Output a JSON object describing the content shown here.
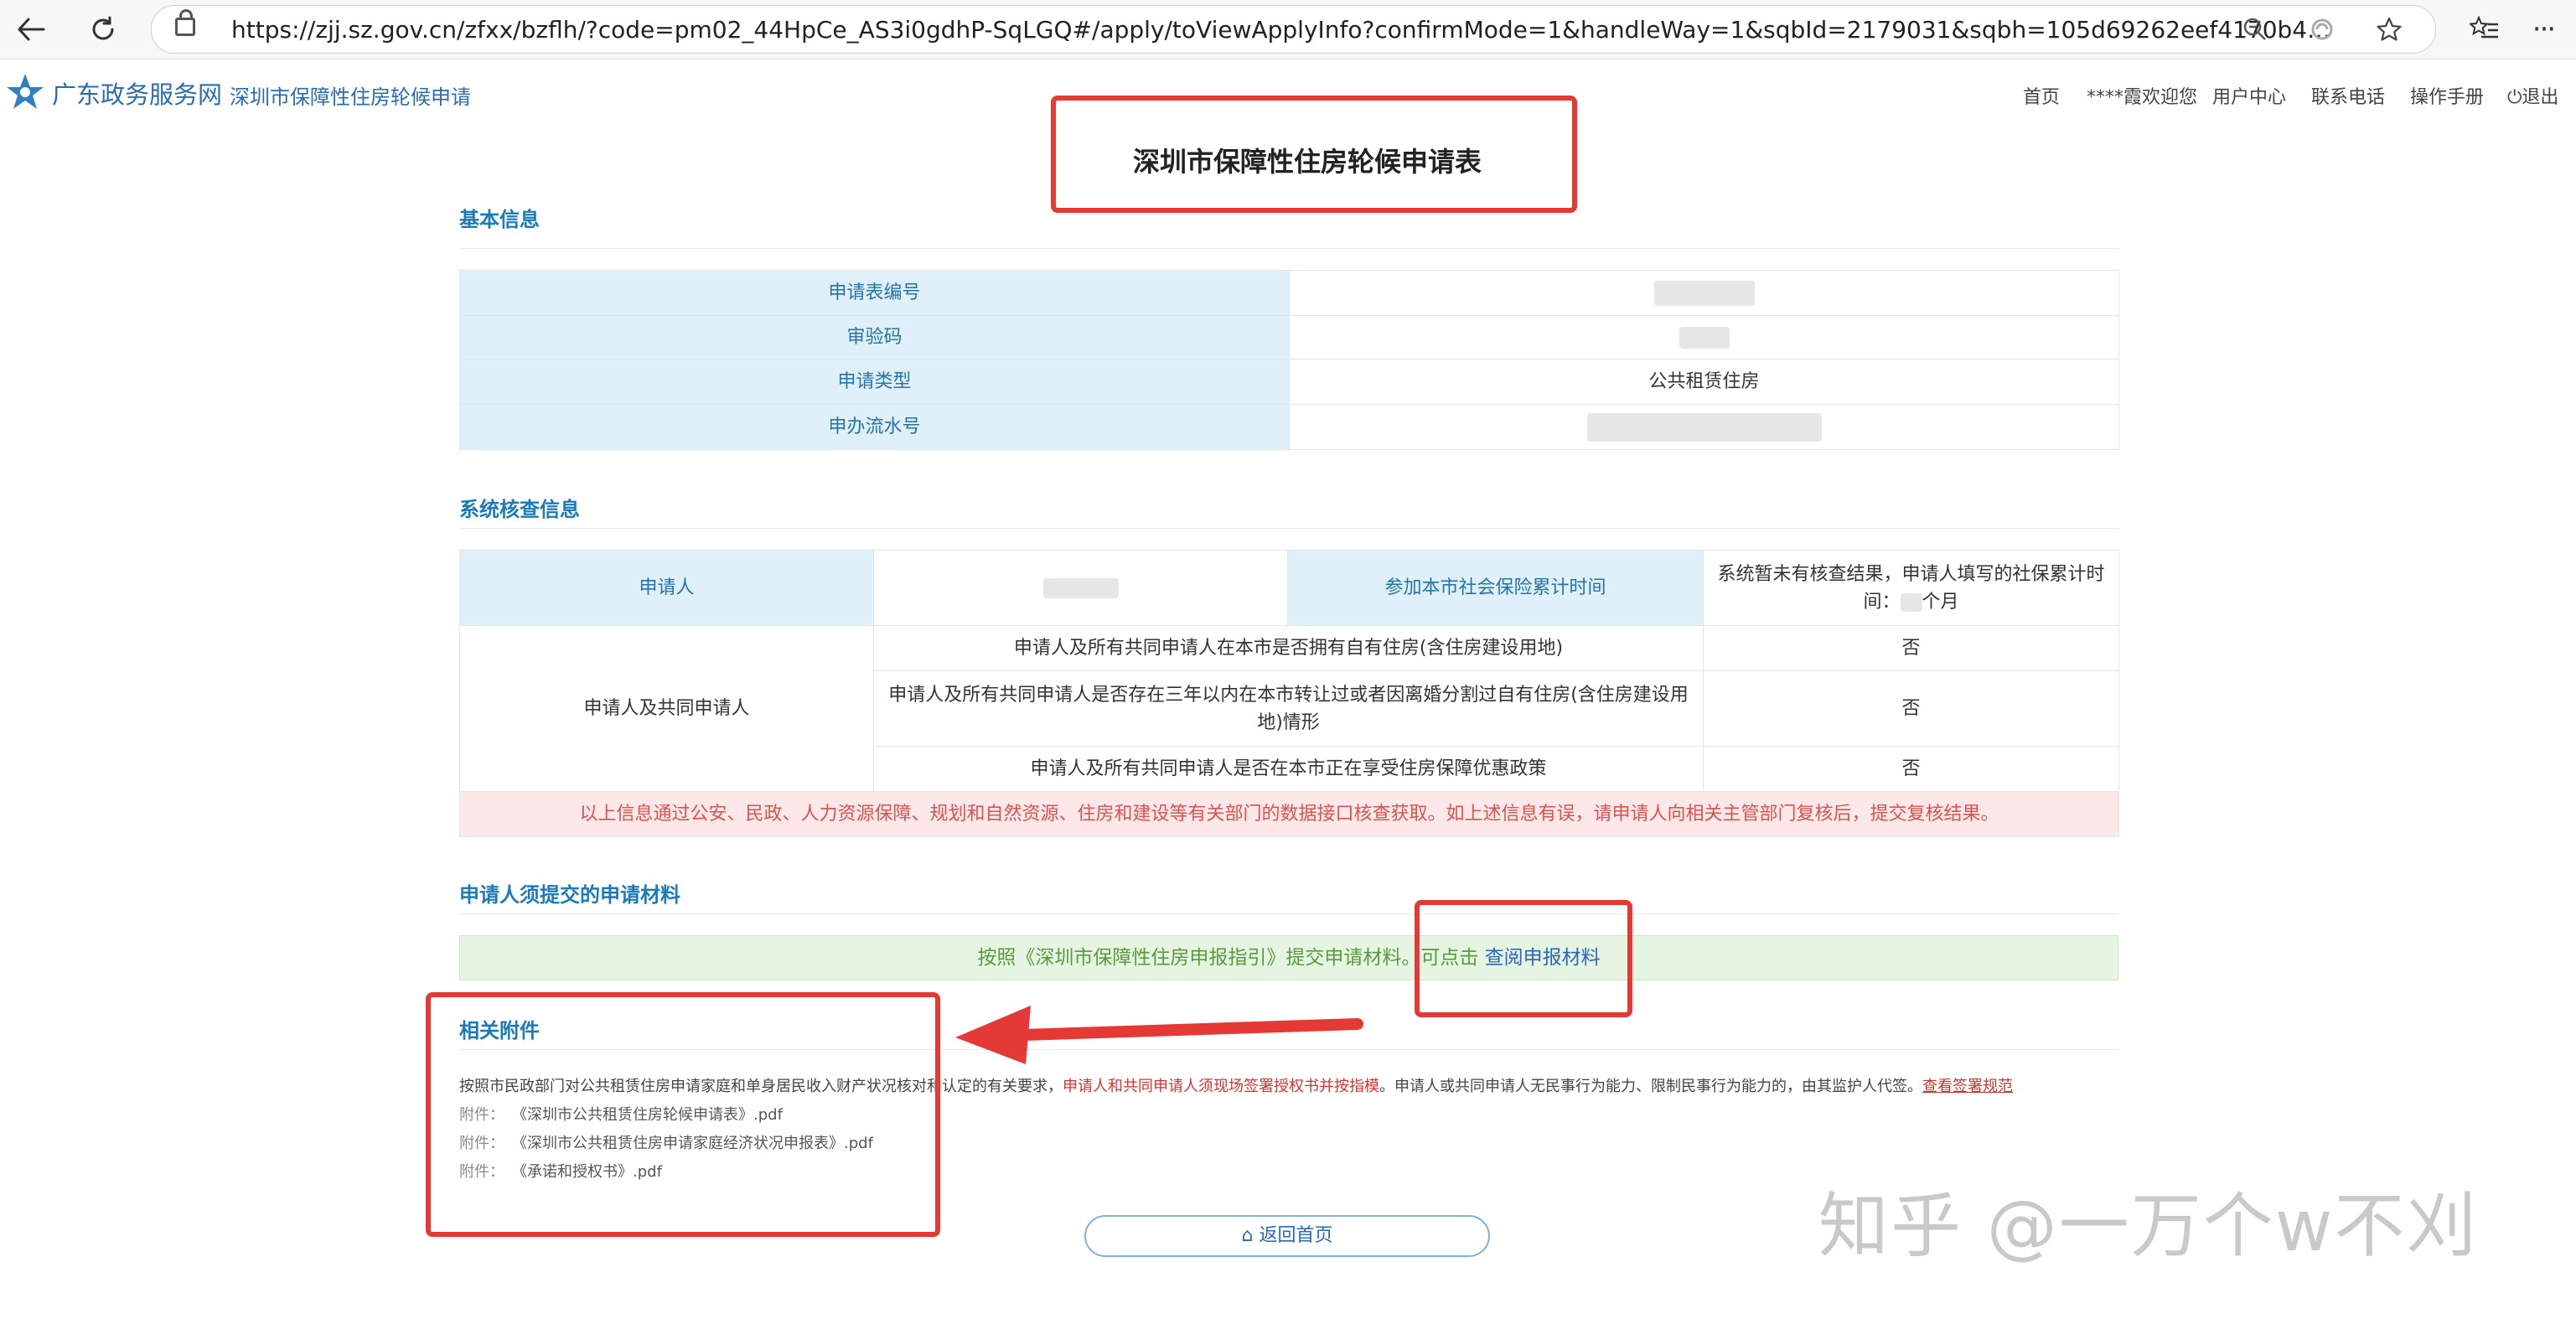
{
  "browser": {
    "url": "https://zjj.sz.gov.cn/zfxx/bzflh/?code=pm02_44HpCe_AS3i0gdhP-SqLGQ#/apply/toViewApplyInfo?confirmMode=1&handleWay=1&sqbId=2179031&sqbh=105d69262eef4170b48f75449ecc...",
    "icons": [
      "back-arrow-icon",
      "refresh-icon",
      "lock-icon",
      "zoom-icon",
      "tracking-icon",
      "favorite-star-icon",
      "favorites-list-icon",
      "more-icon"
    ]
  },
  "header": {
    "brand": "广东政务服务网",
    "subtitle": "深圳市保障性住房轮候申请",
    "nav": [
      "首页",
      "****霞欢迎您",
      "用户中心",
      "联系电话",
      "操作手册",
      "退出"
    ]
  },
  "page": {
    "title": "深圳市保障性住房轮候申请表"
  },
  "basic_info": {
    "section_title": "基本信息",
    "rows": [
      {
        "label": "申请表编号",
        "value": ""
      },
      {
        "label": "审验码",
        "value": ""
      },
      {
        "label": "申请类型",
        "value": "公共租赁住房"
      },
      {
        "label": "申办流水号",
        "value": ""
      }
    ]
  },
  "system_check": {
    "section_title": "系统核查信息",
    "applicant_label": "申请人",
    "social_insurance_label": "参加本市社会保险累计时间",
    "social_insurance_value_line1": "系统暂未有核查结果，申请人填写的社保累计时",
    "social_insurance_value_line2a": "间：",
    "social_insurance_value_line2b": "个月",
    "group_label": "申请人及共同申请人",
    "questions": [
      {
        "q": "申请人及所有共同申请人在本市是否拥有自有住房(含住房建设用地)",
        "a": "否"
      },
      {
        "q": "申请人及所有共同申请人是否存在三年以内在本市转让过或者因离婚分割过自有住房(含住房建设用地)情形",
        "a": "否"
      },
      {
        "q": "申请人及所有共同申请人是否在本市正在享受住房保障优惠政策",
        "a": "否"
      }
    ],
    "notice": "以上信息通过公安、民政、人力资源保障、规划和自然资源、住房和建设等有关部门的数据接口核查获取。如上述信息有误，请申请人向相关主管部门复核后，提交复核结果。"
  },
  "materials": {
    "section_title": "申请人须提交的申请材料",
    "notice_text": "按照《深圳市保障性住房申报指引》提交申请材料。可点击",
    "notice_link": "查阅申报材料"
  },
  "attachments": {
    "section_title": "相关附件",
    "desc_part1": "按照市民政部门对公共租赁住房申请家庭和单身居民收入财产状况核对和认定的有关要求，",
    "desc_red": "申请人和共同申请人须现场签署授权书并按指模",
    "desc_part2": "。申请人或共同申请人无民事行为能力、限制民事行为能力的，由其监护人代签。",
    "desc_link": "查看签署规范",
    "prefix": "附件：",
    "files": [
      "《深圳市公共租赁住房轮候申请表》.pdf",
      "《深圳市公共租赁住房申请家庭经济状况申报表》.pdf",
      "《承诺和授权书》.pdf"
    ]
  },
  "footer": {
    "back_button": "返回首页",
    "watermark": "知乎 @一万个w不刈"
  },
  "colors": {
    "annotation_red": "#e53935",
    "label_bg": "#dff0f9",
    "label_text": "#2474a8",
    "section_title": "#1b7bb8",
    "notice_red": "#d9534f"
  }
}
